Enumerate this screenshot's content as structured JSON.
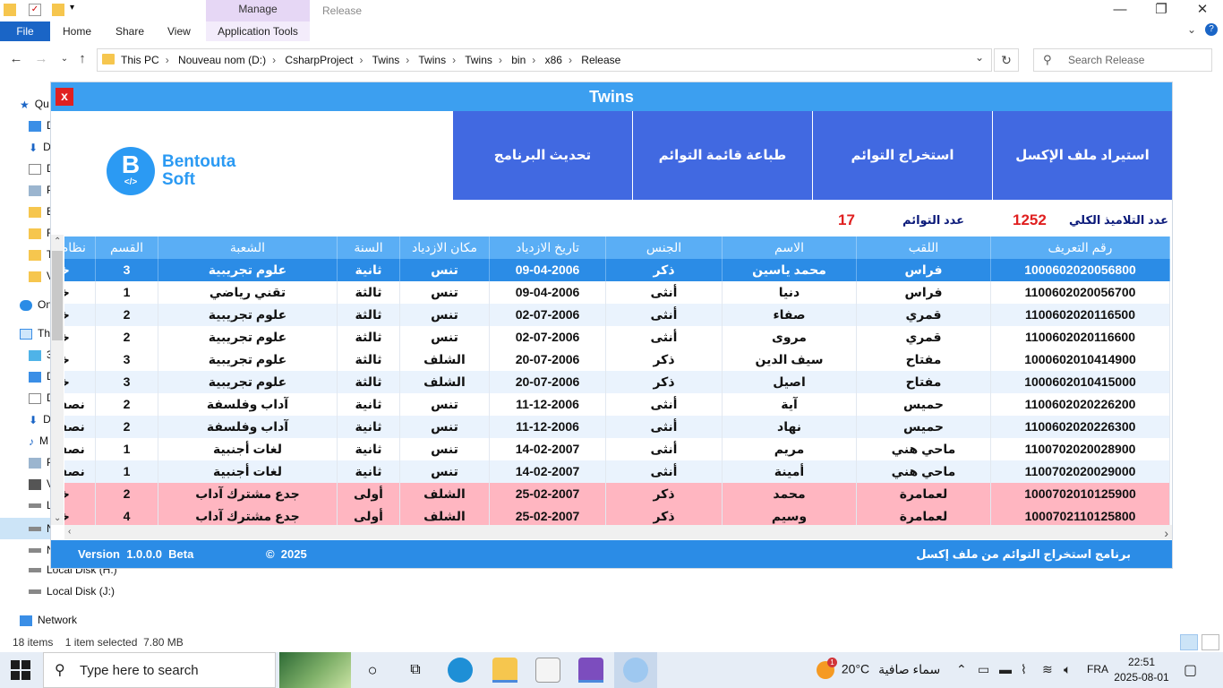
{
  "explorer": {
    "manage_tab": "Manage",
    "window_title": "Release",
    "tabs": {
      "file": "File",
      "home": "Home",
      "share": "Share",
      "view": "View",
      "app_tools": "Application Tools"
    },
    "breadcrumbs": [
      "This PC",
      "Nouveau nom (D:)",
      "CsharpProject",
      "Twins",
      "Twins",
      "Twins",
      "bin",
      "x86",
      "Release"
    ],
    "search_placeholder": "Search Release",
    "nav_items": [
      "Qu",
      "D",
      "D",
      "D",
      "P",
      "B",
      "F",
      "T",
      "V",
      "On",
      "Th",
      "3",
      "D",
      "D",
      "D",
      "M",
      "P",
      "V",
      "L",
      "N",
      "N",
      "Local Disk (H:)",
      "Local Disk (J:)",
      "Network"
    ],
    "status": "18 items    1 item selected  7.80 MB"
  },
  "app": {
    "title": "Twins",
    "close_label": "x",
    "logo": {
      "letter": "B",
      "code": "</>",
      "line1": "Bentouta",
      "line2": "Soft"
    },
    "buttons": {
      "import_excel": "استيراد ملف الإكسل",
      "extract_twins": "استخراج التوائم",
      "print_twins": "طباعة قائمة التوائم",
      "update_program": "تحديث البرنامج"
    },
    "stats": {
      "total_students_label": "عدد التلاميذ الكلي",
      "total_students": "1252",
      "twins_label": "عدد التوائم",
      "twins": "17"
    },
    "columns": [
      "رقم التعريف",
      "اللقب",
      "الاسم",
      "الجنس",
      "تاريخ الازدياد",
      "مكان الازدياد",
      "السنة",
      "الشعبة",
      "القسم",
      "نظام التمدرس"
    ],
    "rows": [
      {
        "id": "1000602020056800",
        "last": "فراس",
        "first": "محمد ياسين",
        "sex": "ذكر",
        "dob": "09-04-2006",
        "pob": "تنس",
        "year": "ثانية",
        "branch": "علوم تجريبية",
        "section": "3",
        "regime": "خارجي",
        "style": "selected"
      },
      {
        "id": "1100602020056700",
        "last": "فراس",
        "first": "دنيا",
        "sex": "أنثى",
        "dob": "09-04-2006",
        "pob": "تنس",
        "year": "ثالثة",
        "branch": "تقني رياضي",
        "section": "1",
        "regime": "خارجي",
        "style": "white"
      },
      {
        "id": "1100602020116500",
        "last": "قمري",
        "first": "صفاء",
        "sex": "أنثى",
        "dob": "02-07-2006",
        "pob": "تنس",
        "year": "ثالثة",
        "branch": "علوم تجريبية",
        "section": "2",
        "regime": "خارجي",
        "style": "alt"
      },
      {
        "id": "1100602020116600",
        "last": "قمري",
        "first": "مروى",
        "sex": "أنثى",
        "dob": "02-07-2006",
        "pob": "تنس",
        "year": "ثالثة",
        "branch": "علوم تجريبية",
        "section": "2",
        "regime": "خارجي",
        "style": "white"
      },
      {
        "id": "1000602010414900",
        "last": "مفتاح",
        "first": "سيف الدين",
        "sex": "ذكر",
        "dob": "20-07-2006",
        "pob": "الشلف",
        "year": "ثالثة",
        "branch": "علوم تجريبية",
        "section": "3",
        "regime": "خارجي",
        "style": "white"
      },
      {
        "id": "1000602010415000",
        "last": "مفتاح",
        "first": "اصيل",
        "sex": "ذكر",
        "dob": "20-07-2006",
        "pob": "الشلف",
        "year": "ثالثة",
        "branch": "علوم تجريبية",
        "section": "3",
        "regime": "خارجي",
        "style": "alt"
      },
      {
        "id": "1100602020226200",
        "last": "حميس",
        "first": "آية",
        "sex": "أنثى",
        "dob": "11-12-2006",
        "pob": "تنس",
        "year": "ثانية",
        "branch": "آداب وفلسفة",
        "section": "2",
        "regime": "نصف داخلي",
        "style": "white"
      },
      {
        "id": "1100602020226300",
        "last": "حميس",
        "first": "نهاد",
        "sex": "أنثى",
        "dob": "11-12-2006",
        "pob": "تنس",
        "year": "ثانية",
        "branch": "آداب وفلسفة",
        "section": "2",
        "regime": "نصف داخلي",
        "style": "alt"
      },
      {
        "id": "1100702020028900",
        "last": "ماحي هني",
        "first": "مريم",
        "sex": "أنثى",
        "dob": "14-02-2007",
        "pob": "تنس",
        "year": "ثانية",
        "branch": "لغات أجنبية",
        "section": "1",
        "regime": "نصف داخلي",
        "style": "white"
      },
      {
        "id": "1100702020029000",
        "last": "ماحي هني",
        "first": "أمينة",
        "sex": "أنثى",
        "dob": "14-02-2007",
        "pob": "تنس",
        "year": "ثانية",
        "branch": "لغات أجنبية",
        "section": "1",
        "regime": "نصف داخلي",
        "style": "alt"
      },
      {
        "id": "1000702010125900",
        "last": "لعمامرة",
        "first": "محمد",
        "sex": "ذكر",
        "dob": "25-02-2007",
        "pob": "الشلف",
        "year": "أولى",
        "branch": "جدع مشترك آداب",
        "section": "2",
        "regime": "خارجي",
        "style": "pink"
      },
      {
        "id": "1000702110125800",
        "last": "لعمامرة",
        "first": "وسيم",
        "sex": "ذكر",
        "dob": "25-02-2007",
        "pob": "الشلف",
        "year": "أولى",
        "branch": "جدع مشترك آداب",
        "section": "4",
        "regime": "خارجي",
        "style": "pink"
      }
    ],
    "footer": {
      "version": "Version  1.0.0.0  Beta",
      "copyright": "©  2025",
      "description": "برنامج استخراج التوائم من ملف إكسل"
    },
    "colors": {
      "titlebar": "#3c9ff0",
      "button": "#4169e1",
      "header": "#5aaef5",
      "selected_row": "#2b8ce6",
      "alt_row": "#eaf3fd",
      "pink_row": "#ffb6c1",
      "footer": "#2b8ce6",
      "stat_value": "#e02020"
    }
  },
  "taskbar": {
    "search_placeholder": "Type here to search",
    "weather_temp": "20°C",
    "weather_text": "سماء صافية",
    "weather_badge": "1",
    "lang": "FRA",
    "time": "22:51",
    "date": "2025-08-01"
  }
}
